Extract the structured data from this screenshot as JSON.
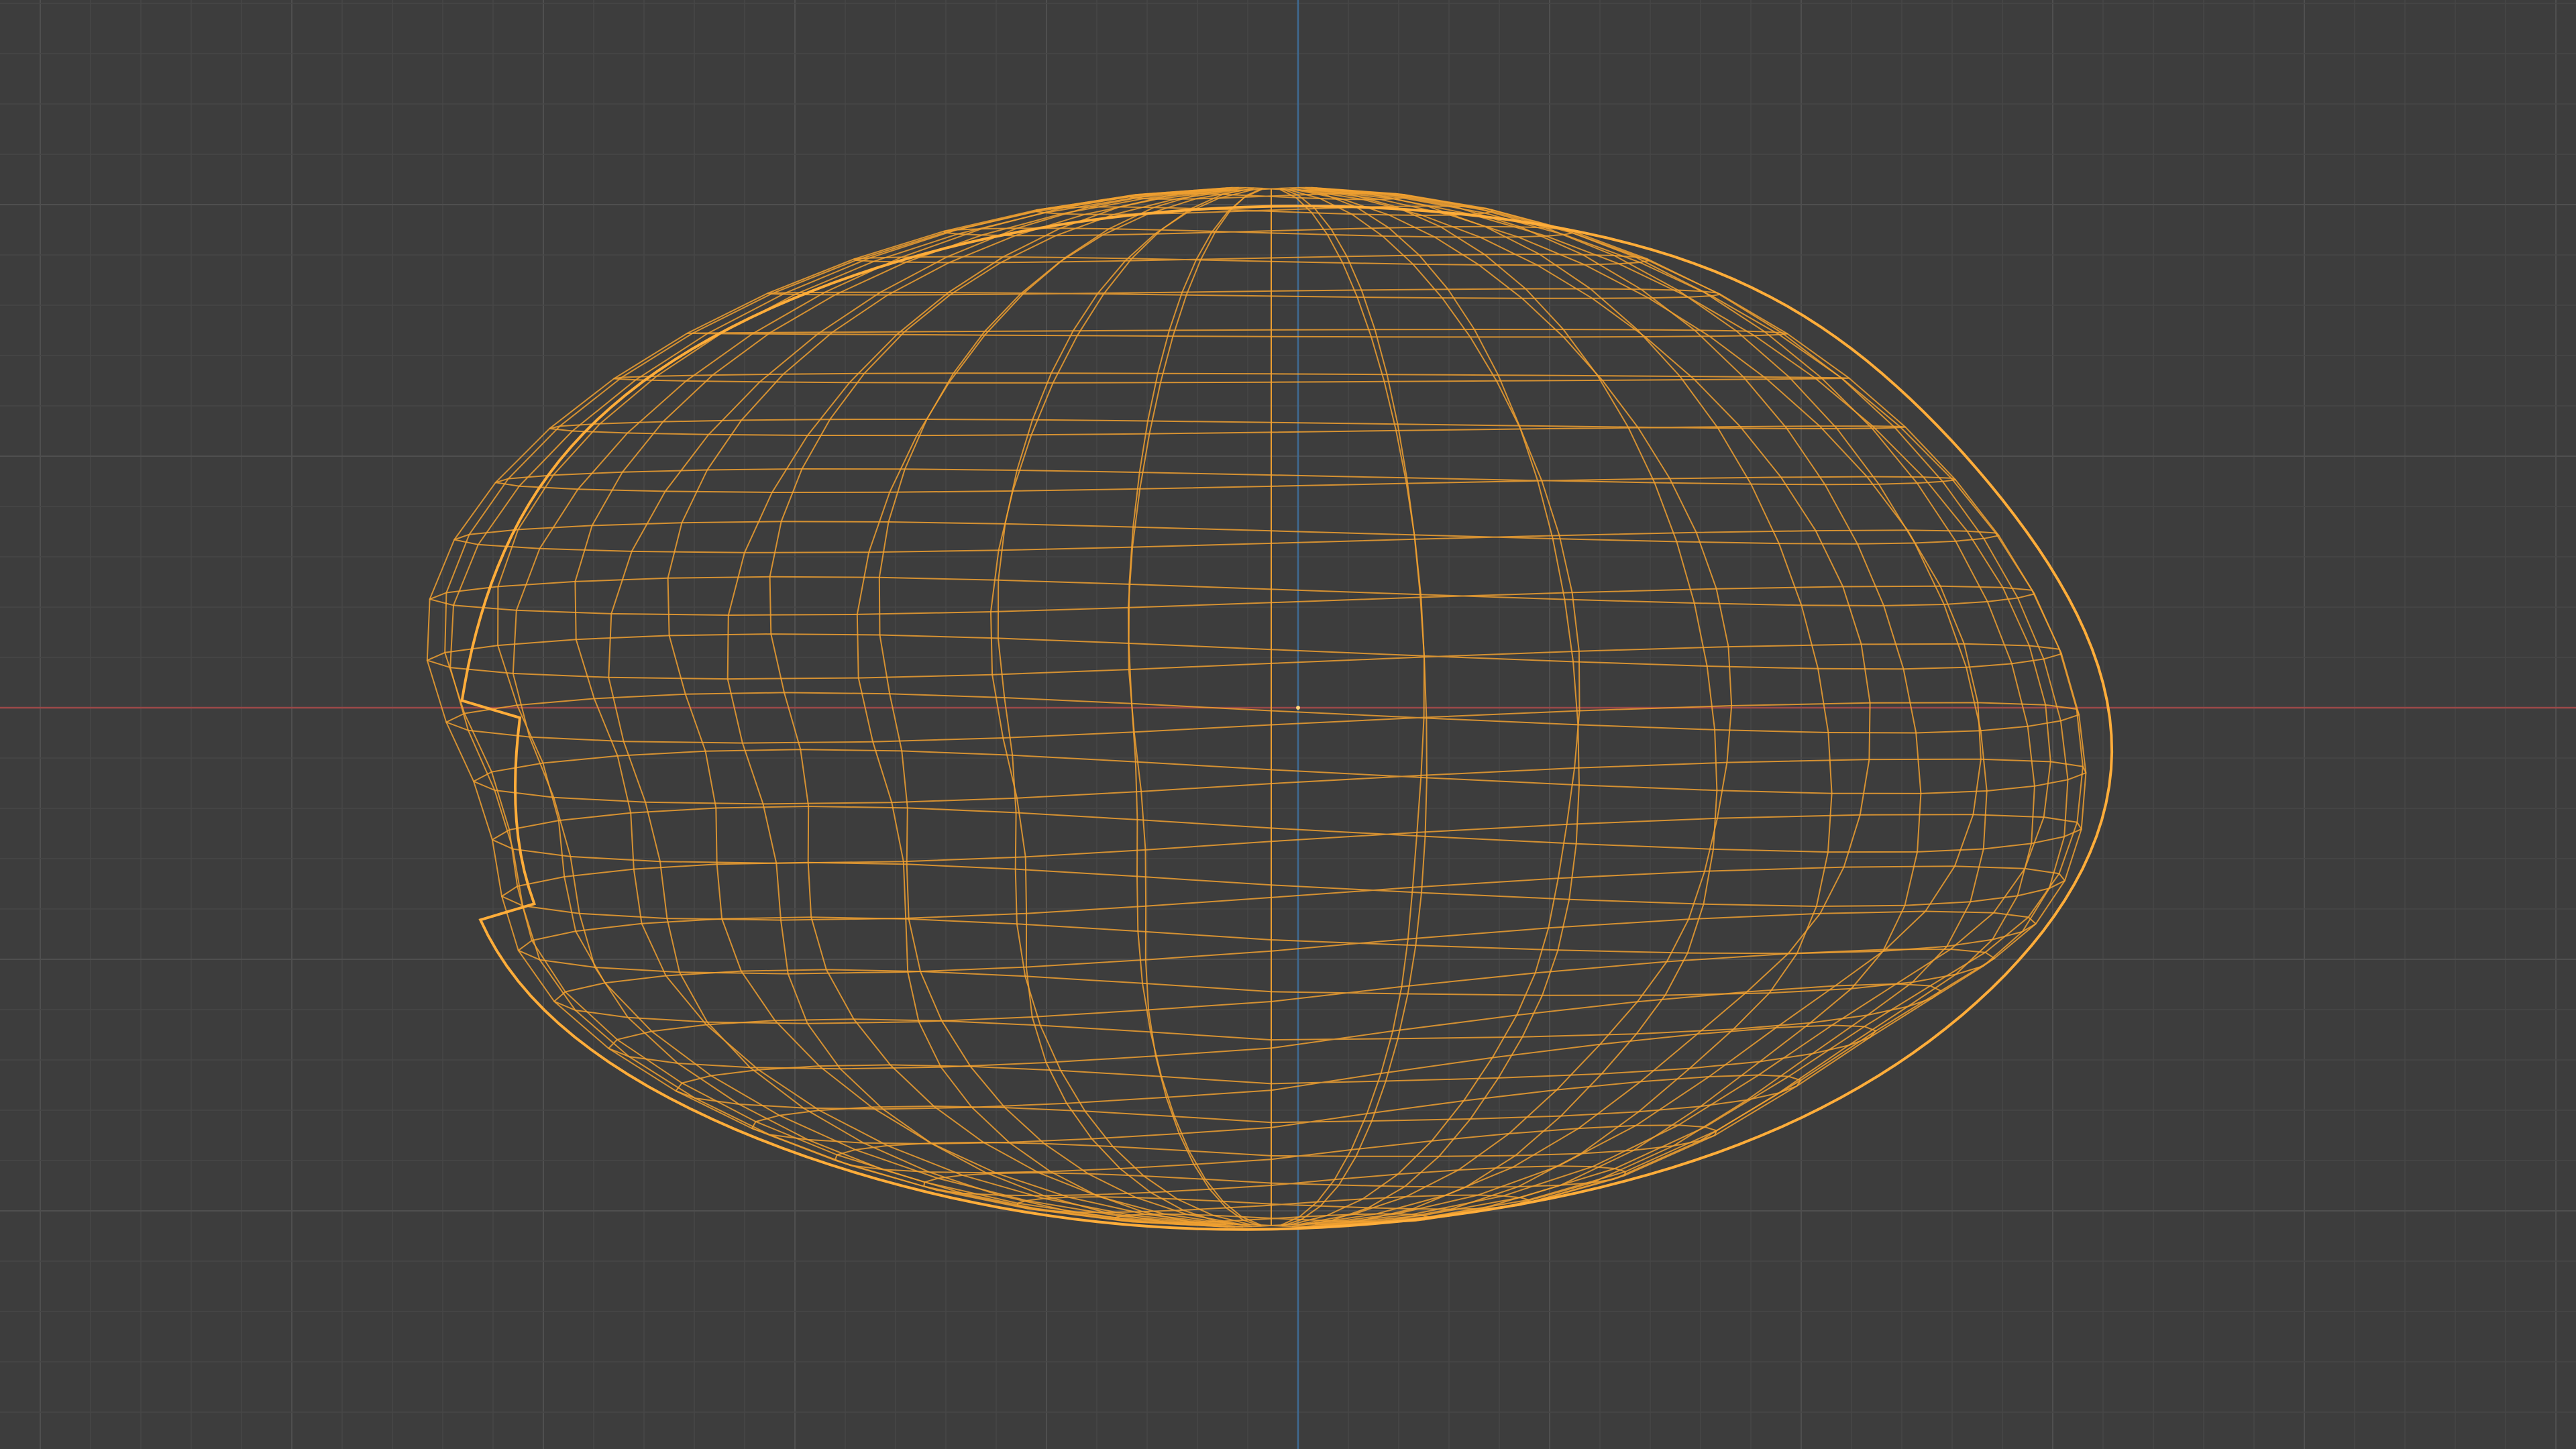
{
  "viewport": {
    "view": "front-orthographic",
    "shading": "wireframe",
    "object_selected": true
  },
  "colors": {
    "background": "#3d3d3d",
    "grid_minor": "#474747",
    "grid_major": "#4f4f4f",
    "axis_x": "#9c4848",
    "axis_z": "#3f6a92",
    "wire_selected": "#f0a030",
    "wire_outline": "#ffad3a",
    "origin_dot": "#ffd27a"
  },
  "icons": {
    "origin": "object-origin-icon"
  }
}
